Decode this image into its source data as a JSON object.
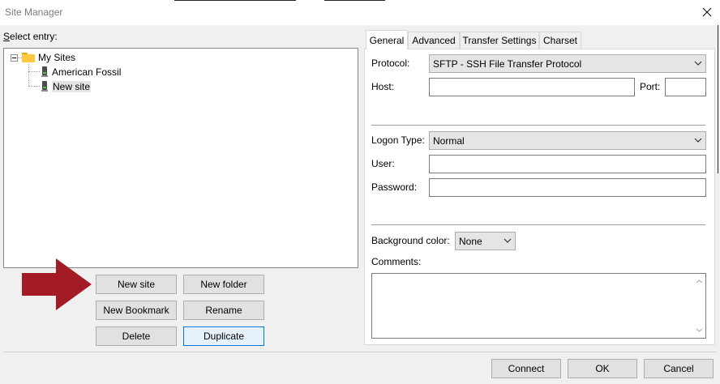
{
  "window": {
    "title": "Site Manager"
  },
  "left": {
    "select_label": "Select entry:",
    "tree": {
      "root": "My Sites",
      "children": [
        "American Fossil",
        "New site"
      ],
      "selected": "New site"
    },
    "buttons": {
      "new_site": "New site",
      "new_folder": "New folder",
      "new_bookmark": "New Bookmark",
      "rename": "Rename",
      "delete": "Delete",
      "duplicate": "Duplicate"
    }
  },
  "tabs": [
    "General",
    "Advanced",
    "Transfer Settings",
    "Charset"
  ],
  "active_tab": "General",
  "general": {
    "protocol_label": "Protocol:",
    "protocol_value": "SFTP - SSH File Transfer Protocol",
    "host_label": "Host:",
    "host_value": "",
    "port_label": "Port:",
    "port_value": "",
    "logon_label": "Logon Type:",
    "logon_value": "Normal",
    "user_label": "User:",
    "user_value": "",
    "password_label": "Password:",
    "password_value": "",
    "bgcolor_label": "Background color:",
    "bgcolor_value": "None",
    "comments_label": "Comments:",
    "comments_value": ""
  },
  "footer": {
    "connect": "Connect",
    "ok": "OK",
    "cancel": "Cancel"
  },
  "colors": {
    "arrow": "#a31b24",
    "focus_border": "#0078d7",
    "folder": "#ffc83d"
  },
  "icons": [
    "close-icon",
    "folder-icon",
    "server-icon",
    "chevron-down-icon",
    "arrow-pointer-icon"
  ]
}
